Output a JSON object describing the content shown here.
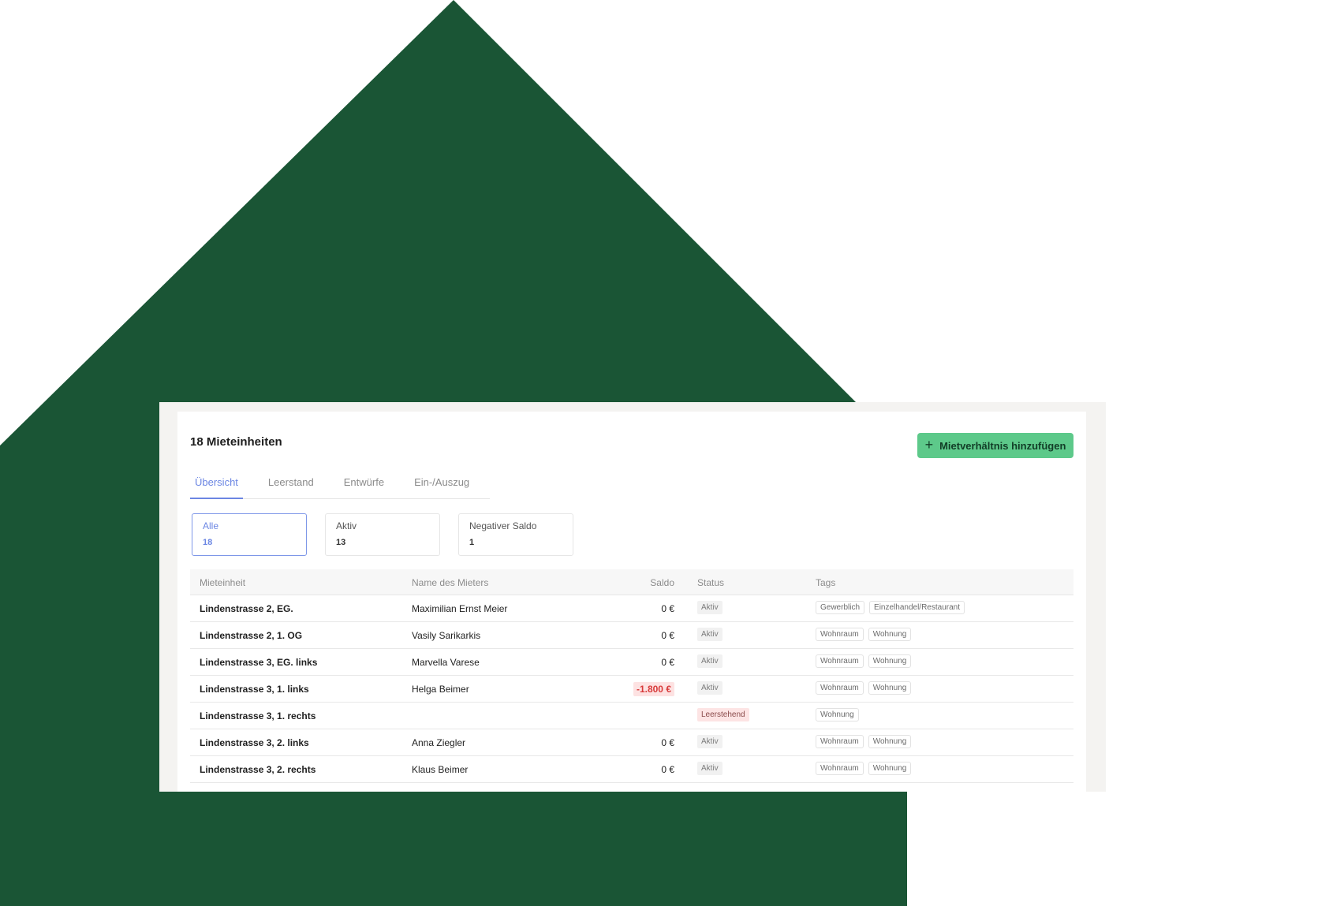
{
  "colors": {
    "background_shape": "#1a5535",
    "accent": "#6b86e3",
    "primary_button": "#5dc98a",
    "negative": "#d83a3a"
  },
  "header": {
    "title": "18 Mieteinheiten",
    "add_button_label": "Mietverhältnis hinzufügen",
    "add_button_icon": "plus-icon"
  },
  "tabs": [
    {
      "label": "Übersicht",
      "active": true
    },
    {
      "label": "Leerstand",
      "active": false
    },
    {
      "label": "Entwürfe",
      "active": false
    },
    {
      "label": "Ein-/Auszug",
      "active": false
    }
  ],
  "filters": [
    {
      "label": "Alle",
      "count": "18",
      "selected": true
    },
    {
      "label": "Aktiv",
      "count": "13",
      "selected": false
    },
    {
      "label": "Negativer Saldo",
      "count": "1",
      "selected": false
    }
  ],
  "table": {
    "columns": {
      "unit": "Mieteinheit",
      "tenant": "Name des Mieters",
      "saldo": "Saldo",
      "status": "Status",
      "tags": "Tags"
    },
    "rows": [
      {
        "unit": "Lindenstrasse 2, EG.",
        "tenant": "Maximilian Ernst Meier",
        "saldo": "0  €",
        "status": "Aktiv",
        "tag1": "Gewerblich",
        "tag2": "Einzelhandel/Restaurant"
      },
      {
        "unit": "Lindenstrasse 2, 1. OG",
        "tenant": "Vasily Sarikarkis",
        "saldo": "0  €",
        "status": "Aktiv",
        "tag1": "Wohnraum",
        "tag2": "Wohnung"
      },
      {
        "unit": "Lindenstrasse 3, EG. links",
        "tenant": "Marvella Varese",
        "saldo": "0  €",
        "status": "Aktiv",
        "tag1": "Wohnraum",
        "tag2": "Wohnung"
      },
      {
        "unit": "Lindenstrasse 3, 1. links",
        "tenant": "Helga Beimer",
        "saldo": "-1.800  €",
        "status": "Aktiv",
        "tag1": "Wohnraum",
        "tag2": "Wohnung"
      },
      {
        "unit": "Lindenstrasse 3, 1. rechts",
        "tenant": "",
        "saldo": "",
        "status": "Leerstehend",
        "tag1": "Wohnung",
        "tag2": ""
      },
      {
        "unit": "Lindenstrasse 3, 2. links",
        "tenant": "Anna Ziegler",
        "saldo": "0  €",
        "status": "Aktiv",
        "tag1": "Wohnraum",
        "tag2": "Wohnung"
      },
      {
        "unit": "Lindenstrasse 3, 2. rechts",
        "tenant": "Klaus Beimer",
        "saldo": "0  €",
        "status": "Aktiv",
        "tag1": "Wohnraum",
        "tag2": "Wohnung"
      }
    ]
  }
}
